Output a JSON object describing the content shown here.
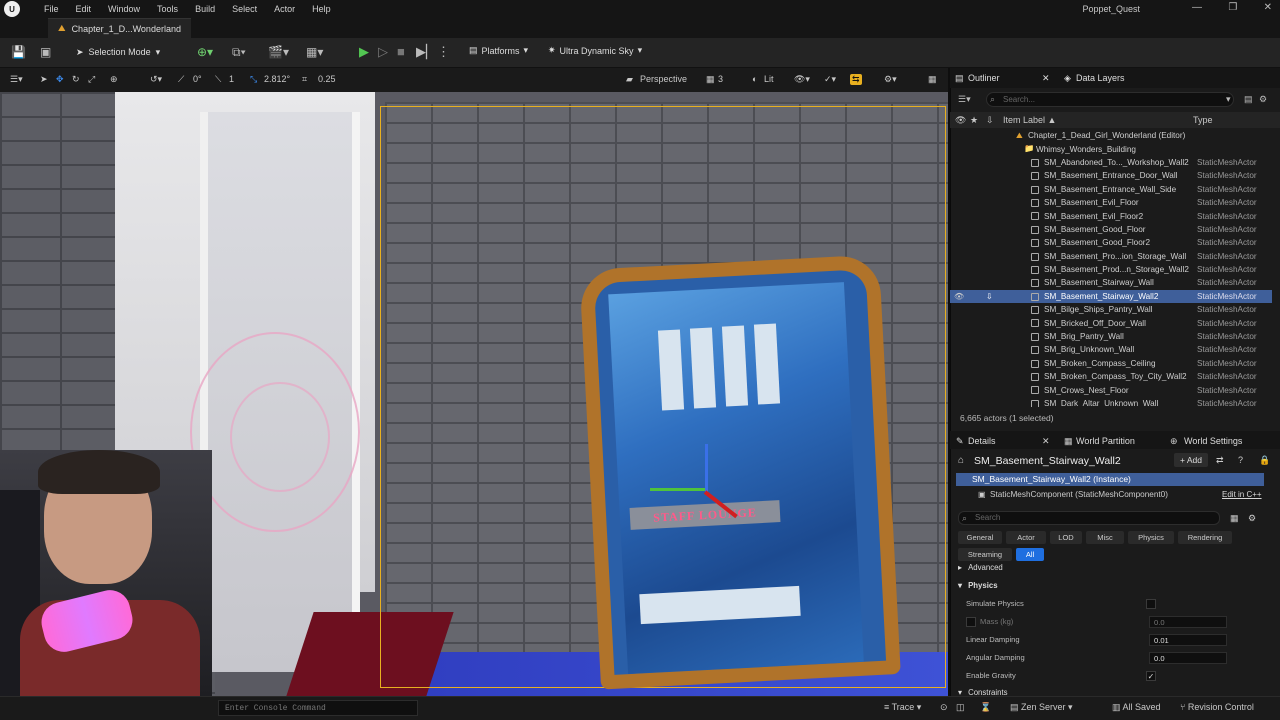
{
  "menubar": {
    "items": [
      "File",
      "Edit",
      "Window",
      "Tools",
      "Build",
      "Select",
      "Actor",
      "Help"
    ],
    "project": "Poppet_Quest",
    "window_controls": [
      "—",
      "❐",
      "✕"
    ]
  },
  "tab": {
    "level": "Chapter_1_D...Wonderland"
  },
  "toolbar": {
    "selection_mode": "Selection Mode",
    "platforms": "Platforms",
    "sky": "Ultra Dynamic Sky"
  },
  "viewport_toolbar": {
    "rot_snap": "0°",
    "grid": "1",
    "scale": "2.812°",
    "move_snap": "0.25",
    "perspective": "Perspective",
    "speed": "3",
    "lit": "Lit"
  },
  "scene": {
    "sign_text": "STAFF LOUNGE"
  },
  "outliner": {
    "tab": "Outliner",
    "tab2": "Data Layers",
    "search_placeholder": "Search...",
    "col_label": "Item Label ▲",
    "col_type": "Type",
    "root": "Chapter_1_Dead_Girl_Wonderland (Editor)",
    "folder": "Whimsy_Wonders_Building",
    "items": [
      {
        "label": "SM_Abandoned_To..._Workshop_Wall2",
        "type": "StaticMeshActor"
      },
      {
        "label": "SM_Basement_Entrance_Door_Wall",
        "type": "StaticMeshActor"
      },
      {
        "label": "SM_Basement_Entrance_Wall_Side",
        "type": "StaticMeshActor"
      },
      {
        "label": "SM_Basement_Evil_Floor",
        "type": "StaticMeshActor"
      },
      {
        "label": "SM_Basement_Evil_Floor2",
        "type": "StaticMeshActor"
      },
      {
        "label": "SM_Basement_Good_Floor",
        "type": "StaticMeshActor"
      },
      {
        "label": "SM_Basement_Good_Floor2",
        "type": "StaticMeshActor"
      },
      {
        "label": "SM_Basement_Pro...ion_Storage_Wall",
        "type": "StaticMeshActor"
      },
      {
        "label": "SM_Basement_Prod...n_Storage_Wall2",
        "type": "StaticMeshActor"
      },
      {
        "label": "SM_Basement_Stairway_Wall",
        "type": "StaticMeshActor"
      },
      {
        "label": "SM_Basement_Stairway_Wall2",
        "type": "StaticMeshActor",
        "selected": true
      },
      {
        "label": "SM_Bilge_Ships_Pantry_Wall",
        "type": "StaticMeshActor"
      },
      {
        "label": "SM_Bricked_Off_Door_Wall",
        "type": "StaticMeshActor"
      },
      {
        "label": "SM_Brig_Pantry_Wall",
        "type": "StaticMeshActor"
      },
      {
        "label": "SM_Brig_Unknown_Wall",
        "type": "StaticMeshActor"
      },
      {
        "label": "SM_Broken_Compass_Ceiling",
        "type": "StaticMeshActor"
      },
      {
        "label": "SM_Broken_Compass_Toy_City_Wall2",
        "type": "StaticMeshActor"
      },
      {
        "label": "SM_Crows_Nest_Floor",
        "type": "StaticMeshActor"
      },
      {
        "label": "SM_Dark_Altar_Unknown_Wall",
        "type": "StaticMeshActor"
      }
    ],
    "actor_count": "6,665 actors (1 selected)"
  },
  "details": {
    "tab": "Details",
    "tab2": "World Partition",
    "tab3": "World Settings",
    "title": "SM_Basement_Stairway_Wall2",
    "add": "+ Add",
    "instance": "SM_Basement_Stairway_Wall2 (Instance)",
    "component": "StaticMeshComponent (StaticMeshComponent0)",
    "edit_cpp": "Edit in C++",
    "search_placeholder": "Search",
    "filters": [
      "General",
      "Actor",
      "LOD",
      "Misc",
      "Physics",
      "Rendering",
      "Streaming",
      "All"
    ],
    "advanced": "Advanced",
    "physics_section": "Physics",
    "props": {
      "simulate": "Simulate Physics",
      "mass": "Mass (kg)",
      "mass_val": "0.0",
      "linear": "Linear Damping",
      "linear_val": "0.01",
      "angular": "Angular Damping",
      "angular_val": "0.0",
      "gravity": "Enable Gravity",
      "constraints": "Constraints"
    }
  },
  "statusbar": {
    "console_placeholder": "Enter Console Command",
    "trace": "Trace",
    "zen": "Zen Server",
    "saved": "All Saved",
    "revision": "Revision Control"
  }
}
